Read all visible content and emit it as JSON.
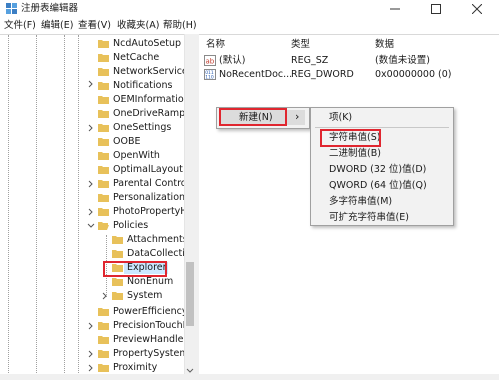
{
  "window": {
    "title": "注册表编辑器",
    "icons": {
      "app": "registry-icon",
      "min": "minimize-icon",
      "max": "maximize-icon",
      "close": "close-icon"
    }
  },
  "menubar": {
    "file": "文件(F)",
    "edit": "编辑(E)",
    "view": "查看(V)",
    "favorites": "收藏夹(A)",
    "help": "帮助(H)"
  },
  "tree": {
    "items": [
      {
        "label": "NcdAutoSetup"
      },
      {
        "label": "NetCache"
      },
      {
        "label": "NetworkServiceTr"
      },
      {
        "label": "Notifications"
      },
      {
        "label": "OEMInformation"
      },
      {
        "label": "OneDriveRamps"
      },
      {
        "label": "OneSettings"
      },
      {
        "label": "OOBE"
      },
      {
        "label": "OpenWith"
      },
      {
        "label": "OptimalLayout"
      },
      {
        "label": "Parental Controls"
      },
      {
        "label": "Personalization"
      },
      {
        "label": "PhotoPropertyHa"
      },
      {
        "label": "Policies"
      },
      {
        "label": "Attachments"
      },
      {
        "label": "DataCollection"
      },
      {
        "label": "Explorer"
      },
      {
        "label": "NonEnum"
      },
      {
        "label": "System"
      },
      {
        "label": "PowerEfficiencyDi"
      },
      {
        "label": "PrecisionTouchPa"
      },
      {
        "label": "PreviewHandlers"
      },
      {
        "label": "PropertySystem"
      },
      {
        "label": "Proximity"
      }
    ]
  },
  "list": {
    "headers": {
      "name": "名称",
      "type": "类型",
      "data": "数据"
    },
    "rows": [
      {
        "name": "(默认)",
        "type": "REG_SZ",
        "data": "(数值未设置)",
        "icon": "string-value-icon"
      },
      {
        "name": "NoRecentDoc...",
        "type": "REG_DWORD",
        "data": "0x00000000 (0)",
        "icon": "binary-value-icon"
      }
    ]
  },
  "context_menu": {
    "new_label": "新建(N)",
    "arrow": "›"
  },
  "submenu": {
    "items": [
      {
        "label": "项(K)"
      },
      {
        "label": "字符串值(S)"
      },
      {
        "label": "二进制值(B)"
      },
      {
        "label": "DWORD (32 位)值(D)"
      },
      {
        "label": "QWORD (64 位)值(Q)"
      },
      {
        "label": "多字符串值(M)"
      },
      {
        "label": "可扩充字符串值(E)"
      }
    ]
  },
  "colors": {
    "highlight": "#e0262f",
    "folder": "#e8c15a",
    "selection": "#cce8ff"
  }
}
